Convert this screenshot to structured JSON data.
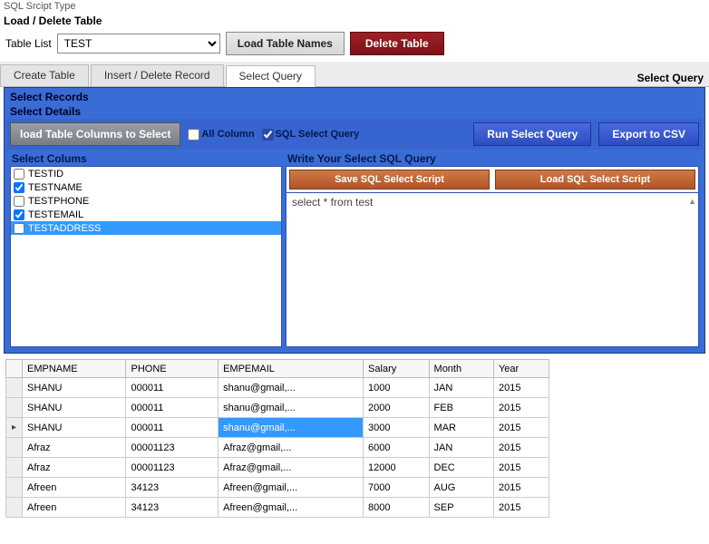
{
  "top_hint": "SQL Srcipt Type",
  "section": "Load / Delete Table",
  "table_list_label": "Table List",
  "table_list_selected": "TEST",
  "btn_load_names": "Load Table Names",
  "btn_delete_table": "Delete Table",
  "tabs": {
    "create": "Create Table",
    "insert": "Insert / Delete Record",
    "select": "Select Query"
  },
  "right_title": "Select Query",
  "panel": {
    "title": "Select Records",
    "subtitle": "Select Details",
    "btn_load_cols": "load Table Columns to Select",
    "chk_all": "All Column",
    "chk_sql": "SQL Select Query",
    "btn_run": "Run Select Query",
    "btn_export": "Export to CSV",
    "cols_head": "Select Colums",
    "columns": [
      {
        "name": "TESTID",
        "checked": false,
        "selected": false
      },
      {
        "name": "TESTNAME",
        "checked": true,
        "selected": false
      },
      {
        "name": "TESTPHONE",
        "checked": false,
        "selected": false
      },
      {
        "name": "TESTEMAIL",
        "checked": true,
        "selected": false
      },
      {
        "name": "TESTADDRESS",
        "checked": false,
        "selected": true
      }
    ],
    "query_head": "Write Your Select SQL Query",
    "btn_save_script": "Save SQL Select Script",
    "btn_load_script": "Load SQL Select Script",
    "sql_text": "select * from test"
  },
  "grid": {
    "columns": [
      "EMPNAME",
      "PHONE",
      "EMPEMAIL",
      "Salary",
      "Month",
      "Year"
    ],
    "rows": [
      {
        "d": [
          "SHANU",
          "000011",
          "shanu@gmail,...",
          "1000",
          "JAN",
          "2015"
        ],
        "active": false,
        "sel": -1
      },
      {
        "d": [
          "SHANU",
          "000011",
          "shanu@gmail,...",
          "2000",
          "FEB",
          "2015"
        ],
        "active": false,
        "sel": -1
      },
      {
        "d": [
          "SHANU",
          "000011",
          "shanu@gmail,...",
          "3000",
          "MAR",
          "2015"
        ],
        "active": true,
        "sel": 2
      },
      {
        "d": [
          "Afraz",
          "00001123",
          "Afraz@gmail,...",
          "6000",
          "JAN",
          "2015"
        ],
        "active": false,
        "sel": -1
      },
      {
        "d": [
          "Afraz",
          "00001123",
          "Afraz@gmail,...",
          "12000",
          "DEC",
          "2015"
        ],
        "active": false,
        "sel": -1
      },
      {
        "d": [
          "Afreen",
          "34123",
          "Afreen@gmail,...",
          "7000",
          "AUG",
          "2015"
        ],
        "active": false,
        "sel": -1
      },
      {
        "d": [
          "Afreen",
          "34123",
          "Afreen@gmail,...",
          "8000",
          "SEP",
          "2015"
        ],
        "active": false,
        "sel": -1
      }
    ]
  }
}
